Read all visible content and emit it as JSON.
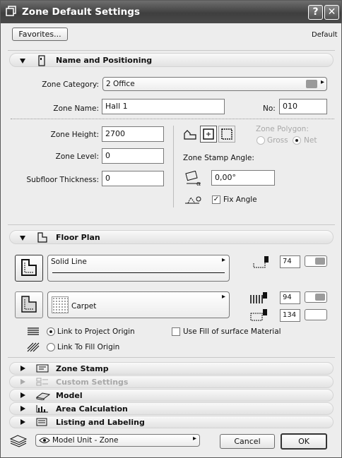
{
  "window": {
    "title": "Zone Default Settings",
    "help_label": "?",
    "close_label": "✕"
  },
  "top": {
    "favorites_label": "Favorites...",
    "default_label": "Default"
  },
  "name_positioning": {
    "header": "Name and Positioning",
    "zone_category_label": "Zone Category:",
    "zone_category_value": "2  Office",
    "zone_name_label": "Zone Name:",
    "zone_name_value": "Hall 1",
    "no_label": "No:",
    "no_value": "010",
    "zone_height_label": "Zone Height:",
    "zone_height_value": "2700",
    "zone_level_label": "Zone Level:",
    "zone_level_value": "0",
    "subfloor_label": "Subfloor Thickness:",
    "subfloor_value": "0",
    "zone_polygon_label": "Zone Polygon:",
    "gross_label": "Gross",
    "net_label": "Net",
    "stamp_angle_label": "Zone Stamp Angle:",
    "stamp_angle_value": "0,00°",
    "fix_angle_label": "Fix Angle",
    "fix_angle_checked": true
  },
  "floor_plan": {
    "header": "Floor Plan",
    "line_type": "Solid Line",
    "line_pen": "74",
    "fill_name": "Carpet",
    "fill_fg_pen": "94",
    "fill_bg_pen": "134",
    "link_project_origin_label": "Link to Project Origin",
    "link_fill_origin_label": "Link To Fill Origin",
    "use_surface_fill_label": "Use Fill of surface Material"
  },
  "sections": [
    {
      "label": "Zone Stamp",
      "enabled": true
    },
    {
      "label": "Custom Settings",
      "enabled": false
    },
    {
      "label": "Model",
      "enabled": true
    },
    {
      "label": "Area Calculation",
      "enabled": true
    },
    {
      "label": "Listing and Labeling",
      "enabled": true
    }
  ],
  "bottom": {
    "model_unit_label": "Model Unit - Zone",
    "cancel_label": "Cancel",
    "ok_label": "OK"
  }
}
